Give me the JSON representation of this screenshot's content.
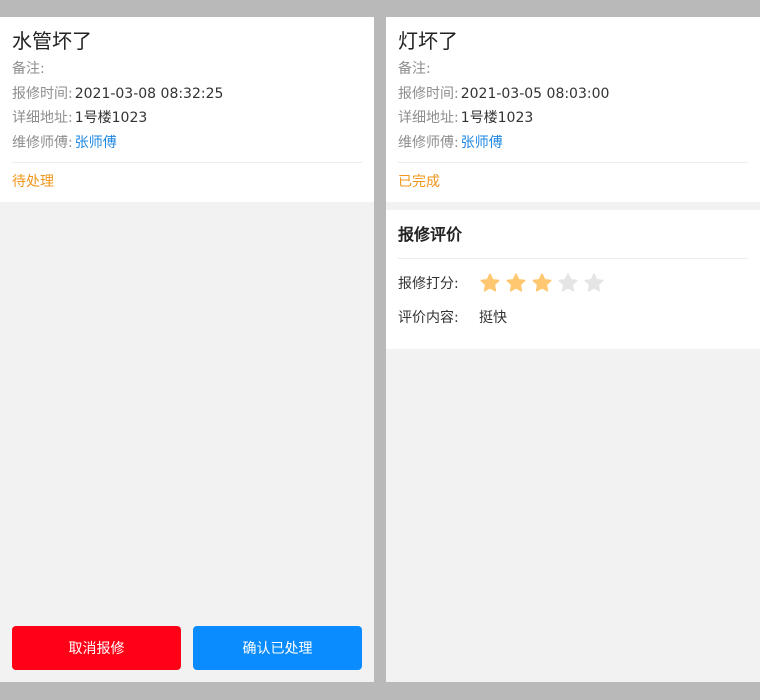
{
  "colors": {
    "frame_bg": "#b9b9b9",
    "page_bg": "#f2f2f2",
    "status_orange": "#f0961a",
    "link_blue": "#1f88e5",
    "cancel_red": "#ff0017",
    "confirm_blue": "#0a8cff",
    "star_active": "#ffc870",
    "star_inactive": "#e5e5e5"
  },
  "left": {
    "title": "水管坏了",
    "remark_label": "备注:",
    "remark_value": "",
    "time_label": "报修时间:",
    "time_value": "2021-03-08 08:32:25",
    "address_label": "详细地址:",
    "address_value": "1号楼1023",
    "worker_label": "维修师傅:",
    "worker_value": "张师傅",
    "status": "待处理",
    "cancel_label": "取消报修",
    "confirm_label": "确认已处理"
  },
  "right": {
    "title": "灯坏了",
    "remark_label": "备注:",
    "remark_value": "",
    "time_label": "报修时间:",
    "time_value": "2021-03-05 08:03:00",
    "address_label": "详细地址:",
    "address_value": "1号楼1023",
    "worker_label": "维修师傅:",
    "worker_value": "张师傅",
    "status": "已完成",
    "evaluation": {
      "title": "报修评价",
      "score_label": "报修打分:",
      "rating": 3,
      "max_rating": 5,
      "content_label": "评价内容:",
      "content_value": "挺快",
      "star_icon": "star-icon"
    }
  }
}
